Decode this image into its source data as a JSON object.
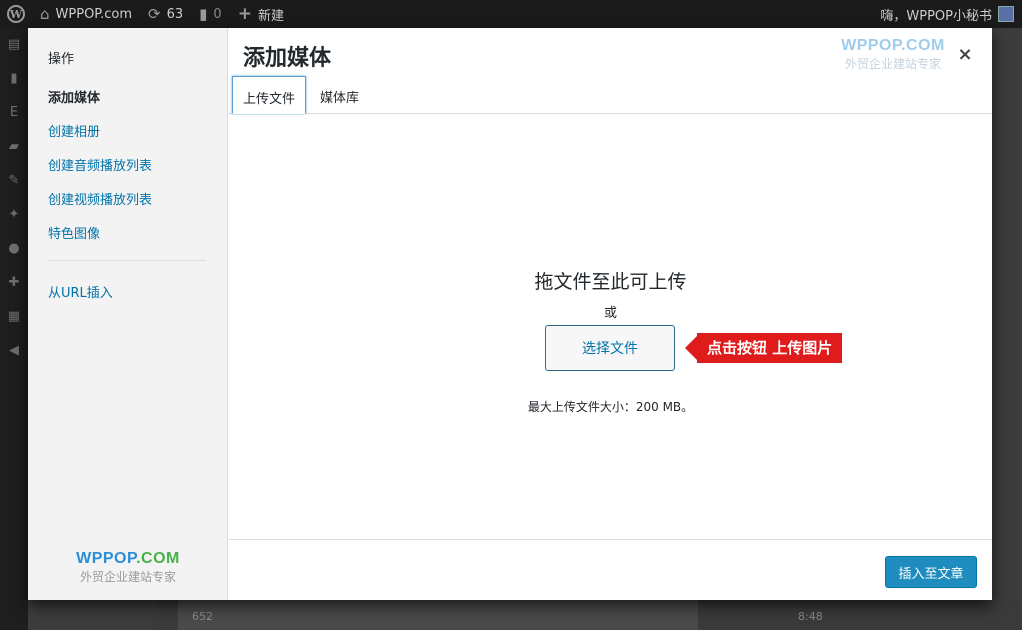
{
  "adminbar": {
    "wp_logo_icon": "wordpress-logo-icon",
    "site_name": "WPPOP.com",
    "updates_count": "63",
    "comments_count": "0",
    "new_label": "新建",
    "greeting": "嗨，WPPOP小秘书"
  },
  "modal": {
    "menu": {
      "heading": "操作",
      "items": [
        "添加媒体",
        "创建相册",
        "创建音频播放列表",
        "创建视频播放列表",
        "特色图像"
      ],
      "url_insert": "从URL插入"
    },
    "brand_left": {
      "name": "WPPOP.COM",
      "tagline": "外贸企业建站专家"
    },
    "brand_right": {
      "name": "WPPOP.COM",
      "tagline": "外贸企业建站专家"
    },
    "title": "添加媒体",
    "close_symbol": "×",
    "tabs": [
      "上传文件",
      "媒体库"
    ],
    "upload": {
      "drop_text": "拖文件至此可上传",
      "or_text": "或",
      "select_button": "选择文件",
      "callout": "点击按钮 上传图片",
      "max_size": "最大上传文件大小：200 MB。"
    },
    "insert_button": "插入至文章"
  },
  "background": {
    "row_left": "652",
    "row_right": "8:48"
  },
  "colors": {
    "accent": "#0073aa",
    "primary_button": "#1e8cbe",
    "callout": "#e01b1b",
    "brand_blue": "#2b8fd6"
  }
}
